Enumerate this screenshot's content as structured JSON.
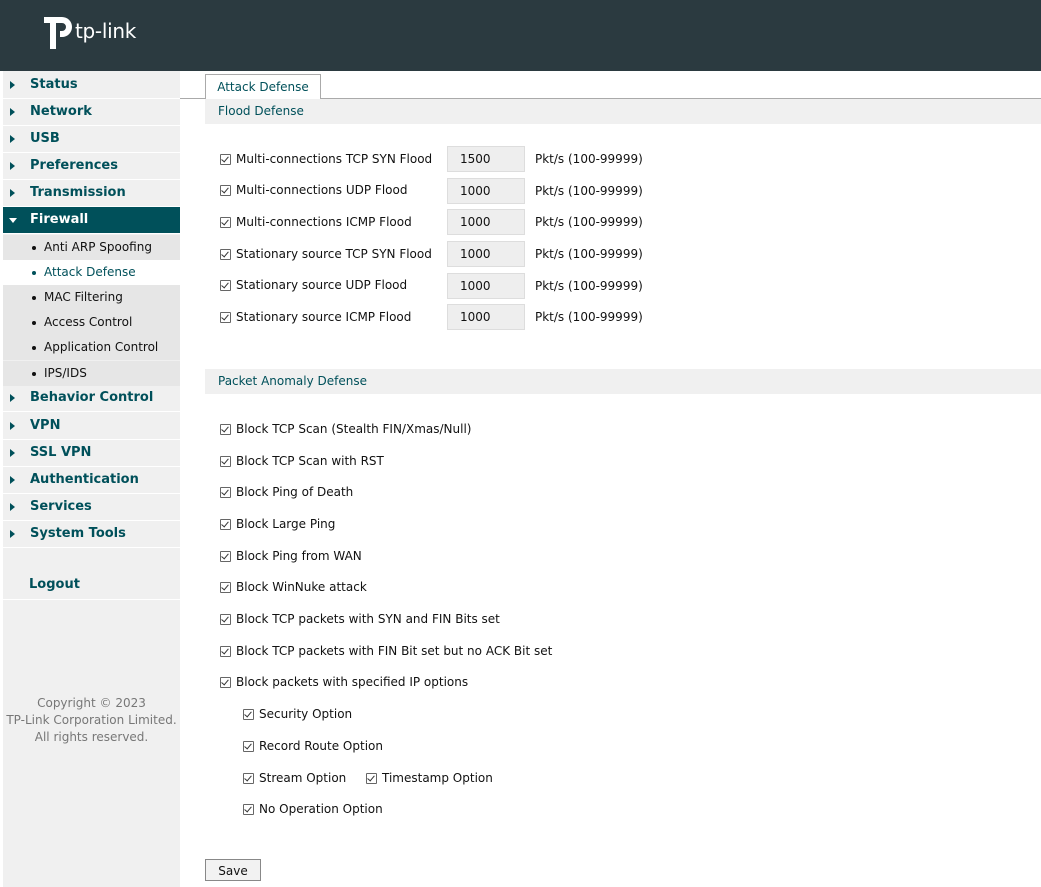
{
  "brand": {
    "logo_text": "tp-link",
    "header_color": "#2b3a40",
    "accent": "#00505a"
  },
  "nav": {
    "items": [
      {
        "label": "Status"
      },
      {
        "label": "Network"
      },
      {
        "label": "USB"
      },
      {
        "label": "Preferences"
      },
      {
        "label": "Transmission"
      },
      {
        "label": "Firewall",
        "active": true
      },
      {
        "label": "Behavior Control"
      },
      {
        "label": "VPN"
      },
      {
        "label": "SSL VPN"
      },
      {
        "label": "Authentication"
      },
      {
        "label": "Services"
      },
      {
        "label": "System Tools"
      }
    ],
    "firewall_sub": [
      {
        "label": "Anti ARP Spoofing"
      },
      {
        "label": "Attack Defense",
        "active": true
      },
      {
        "label": "MAC Filtering"
      },
      {
        "label": "Access Control"
      },
      {
        "label": "Application Control"
      },
      {
        "label": "IPS/IDS"
      }
    ],
    "logout": "Logout"
  },
  "copyright": {
    "line1": "Copyright © 2023",
    "line2": "TP-Link Corporation Limited.",
    "line3": "All rights reserved."
  },
  "tab": {
    "label": "Attack Defense"
  },
  "flood": {
    "title": "Flood Defense",
    "unit": "Pkt/s (100-99999)",
    "rows": [
      {
        "label": "Multi-connections TCP SYN Flood",
        "value": "1500",
        "checked": true
      },
      {
        "label": "Multi-connections UDP Flood",
        "value": "1000",
        "checked": true
      },
      {
        "label": "Multi-connections ICMP Flood",
        "value": "1000",
        "checked": true
      },
      {
        "label": "Stationary source TCP SYN Flood",
        "value": "1000",
        "checked": true
      },
      {
        "label": "Stationary source UDP Flood",
        "value": "1000",
        "checked": true
      },
      {
        "label": "Stationary source ICMP Flood",
        "value": "1000",
        "checked": true
      }
    ]
  },
  "anomaly": {
    "title": "Packet Anomaly Defense",
    "rows": [
      {
        "label": "Block TCP Scan (Stealth FIN/Xmas/Null)",
        "checked": true
      },
      {
        "label": "Block TCP Scan with RST",
        "checked": true
      },
      {
        "label": "Block Ping of Death",
        "checked": true
      },
      {
        "label": "Block Large Ping",
        "checked": true
      },
      {
        "label": "Block Ping from WAN",
        "checked": true
      },
      {
        "label": "Block WinNuke attack",
        "checked": true
      },
      {
        "label": "Block TCP packets with SYN and FIN Bits set",
        "checked": true
      },
      {
        "label": "Block TCP packets with FIN Bit set but no ACK Bit set",
        "checked": true
      },
      {
        "label": "Block packets with specified IP options",
        "checked": true
      }
    ],
    "ip_options": [
      {
        "label": "Security Option",
        "checked": true
      },
      {
        "label": "Record Route Option",
        "checked": true
      },
      {
        "label": "Stream Option",
        "checked": true
      },
      {
        "label": "Timestamp Option",
        "checked": true
      },
      {
        "label": "No Operation Option",
        "checked": true
      }
    ]
  },
  "save_label": "Save"
}
